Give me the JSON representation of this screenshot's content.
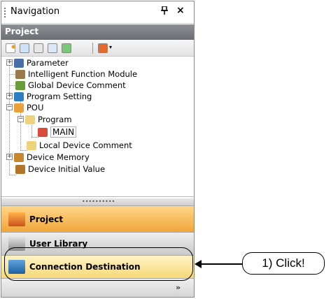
{
  "panel": {
    "title": "Navigation",
    "pin_glyph": "p",
    "close_glyph": "×"
  },
  "section": {
    "header": "Project"
  },
  "tree": {
    "items": [
      {
        "label": "Parameter",
        "icon": "parameter-icon"
      },
      {
        "label": "Intelligent Function Module",
        "icon": "module-icon"
      },
      {
        "label": "Global Device Comment",
        "icon": "comment-icon"
      },
      {
        "label": "Program Setting",
        "icon": "program-setting-icon"
      },
      {
        "label": "POU",
        "icon": "pou-icon"
      },
      {
        "label": "Program",
        "icon": "folder-icon"
      },
      {
        "label": "MAIN",
        "icon": "program-file-icon"
      },
      {
        "label": "Local Device Comment",
        "icon": "folder-icon"
      },
      {
        "label": "Device Memory",
        "icon": "device-memory-icon"
      },
      {
        "label": "Device Initial Value",
        "icon": "device-initial-icon"
      }
    ]
  },
  "nav_buttons": {
    "project": "Project",
    "user_library": "User Library",
    "connection_destination": "Connection Destination"
  },
  "annotation": {
    "callout": "1) Click!"
  },
  "colors": {
    "accent_project": "#f0a63a",
    "accent_connection": "#f6d979"
  }
}
